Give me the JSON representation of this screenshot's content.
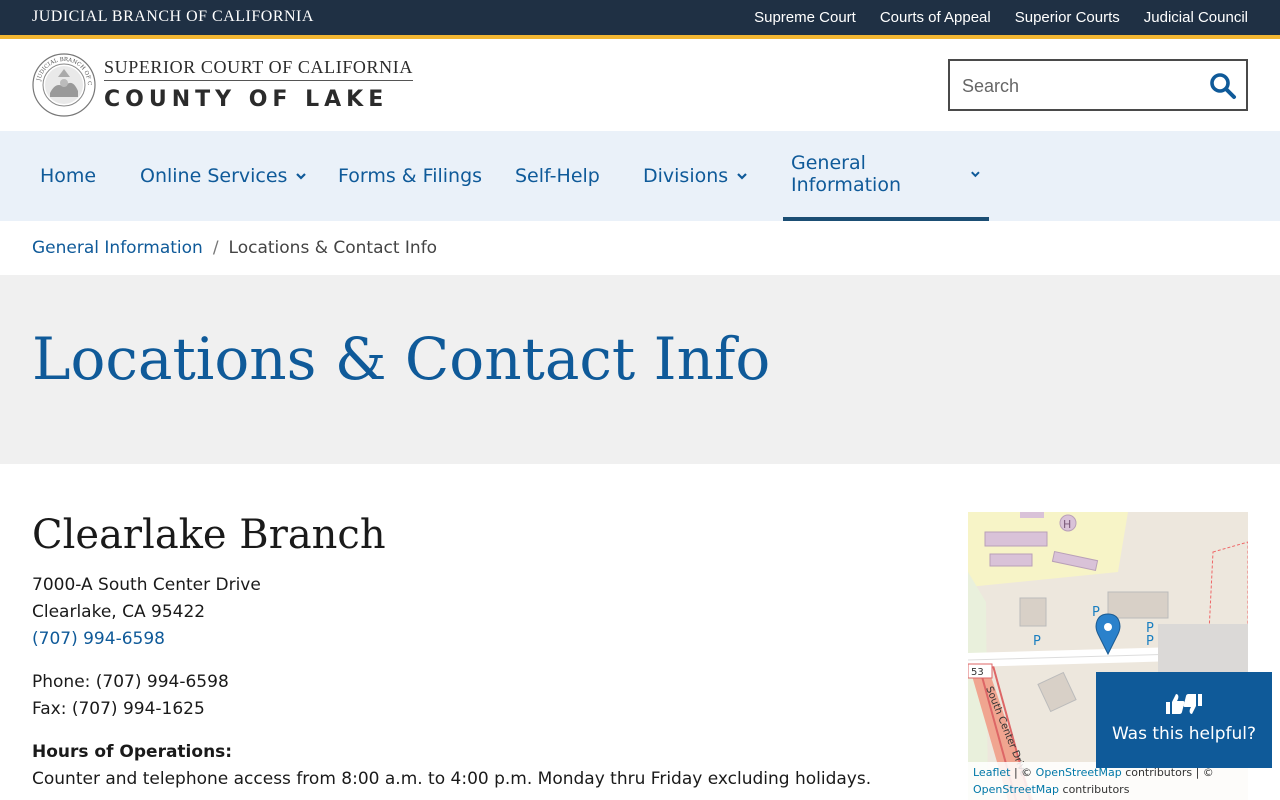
{
  "utility_bar": {
    "branch_name": "JUDICIAL BRANCH OF CALIFORNIA",
    "links": [
      "Supreme Court",
      "Courts of Appeal",
      "Superior Courts",
      "Judicial Council"
    ]
  },
  "header": {
    "logo_line1": "SUPERIOR COURT OF CALIFORNIA",
    "logo_line2": "COUNTY OF LAKE",
    "seal_text": "JUDICIAL BRANCH OF CALIFORNIA"
  },
  "search": {
    "placeholder": "Search",
    "icon": "search-icon"
  },
  "nav": {
    "items": [
      {
        "label": "Home",
        "has_dropdown": false
      },
      {
        "label": "Online Services",
        "has_dropdown": true
      },
      {
        "label": "Forms & Filings",
        "has_dropdown": false
      },
      {
        "label": "Self-Help",
        "has_dropdown": false
      },
      {
        "label": "Divisions",
        "has_dropdown": true
      },
      {
        "label": "General Information",
        "has_dropdown": true,
        "active": true
      }
    ]
  },
  "breadcrumb": {
    "parent": "General Information",
    "separator": "/",
    "current": "Locations & Contact Info"
  },
  "page": {
    "title": "Locations & Contact Info"
  },
  "branch": {
    "name": "Clearlake Branch",
    "address_line1": "7000-A South Center Drive",
    "address_line2": "Clearlake, CA 95422",
    "phone_link": "(707) 994-6598",
    "phone": "Phone: (707) 994-6598",
    "fax": "Fax: (707) 994-1625",
    "hours_label": "Hours of Operations:",
    "hours_text": "Counter and telephone access from 8:00 a.m. to 4:00 p.m. Monday thru Friday excluding holidays."
  },
  "map": {
    "street_label": "South Center Drive",
    "route_label": "53",
    "parking_labels": [
      "P",
      "P",
      "P",
      "P",
      "P"
    ],
    "attribution_leaflet": "Leaflet",
    "attribution_sep": "| ©",
    "attribution_osm": "OpenStreetMap",
    "attribution_contrib": "contributors | ©",
    "attribution_osm2": "OpenStreetMap",
    "attribution_contrib2": "contributors"
  },
  "feedback": {
    "label": "Was this helpful?",
    "icon": "thumbs-up-down-icon"
  },
  "colors": {
    "utility_bg": "#1f3044",
    "accent": "#f2b632",
    "brand_blue": "#0f5a99",
    "nav_bg": "#eaf1f9",
    "title_band_bg": "#f0f0f0"
  }
}
